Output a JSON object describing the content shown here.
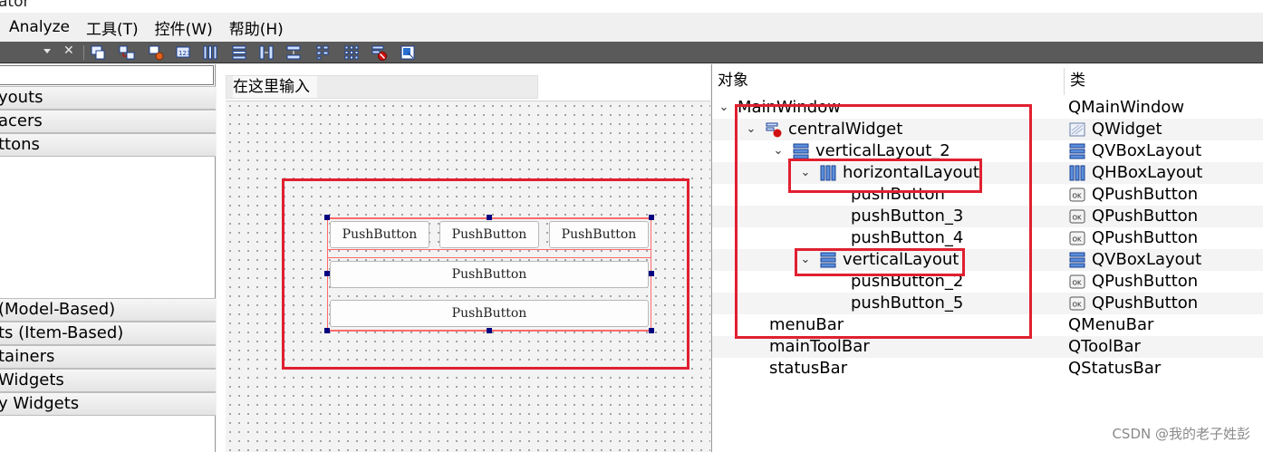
{
  "app": {
    "title_fragment": "ator"
  },
  "menubar": {
    "items": [
      "Analyze",
      "工具(T)",
      "控件(W)",
      "帮助(H)"
    ]
  },
  "toolbar": {
    "buttons": [
      "edit-widgets-icon",
      "edit-signals-icon",
      "edit-buddies-icon",
      "edit-tab-order-icon",
      "layout-horizontal-icon",
      "layout-vertical-icon",
      "layout-horizontal-splitter-icon",
      "layout-vertical-splitter-icon",
      "layout-form-icon",
      "layout-grid-icon",
      "break-layout-icon",
      "adjust-size-icon"
    ]
  },
  "widget_box": {
    "filter_value": "",
    "categories": [
      "youts",
      "acers",
      "ttons",
      "(Model-Based)",
      "ts (Item-Based)",
      "tainers",
      " Widgets",
      "y Widgets"
    ]
  },
  "form": {
    "type_here": "在这里输入",
    "buttons": {
      "b1": "PushButton",
      "b2": "PushButton",
      "b3": "PushButton",
      "b4": "PushButton",
      "b5": "PushButton"
    }
  },
  "object_inspector": {
    "header_object": "对象",
    "header_class": "类",
    "rows": [
      {
        "name": "MainWindow",
        "cls": "QMainWindow"
      },
      {
        "name": "centralWidget",
        "cls": "QWidget"
      },
      {
        "name": "verticalLayout_2",
        "cls": "QVBoxLayout"
      },
      {
        "name": "horizontalLayout",
        "cls": "QHBoxLayout"
      },
      {
        "name": "pushButton",
        "cls": "QPushButton"
      },
      {
        "name": "pushButton_3",
        "cls": "QPushButton"
      },
      {
        "name": "pushButton_4",
        "cls": "QPushButton"
      },
      {
        "name": "verticalLayout",
        "cls": "QVBoxLayout"
      },
      {
        "name": "pushButton_2",
        "cls": "QPushButton"
      },
      {
        "name": "pushButton_5",
        "cls": "QPushButton"
      },
      {
        "name": "menuBar",
        "cls": "QMenuBar"
      },
      {
        "name": "mainToolBar",
        "cls": "QToolBar"
      },
      {
        "name": "statusBar",
        "cls": "QStatusBar"
      }
    ]
  },
  "watermark": "CSDN @我的老子姓彭",
  "colors": {
    "highlight_red": "#e02030",
    "layout_red": "#ff6a6a",
    "handle": "#000080",
    "toolbar": "#5a5a5a"
  }
}
